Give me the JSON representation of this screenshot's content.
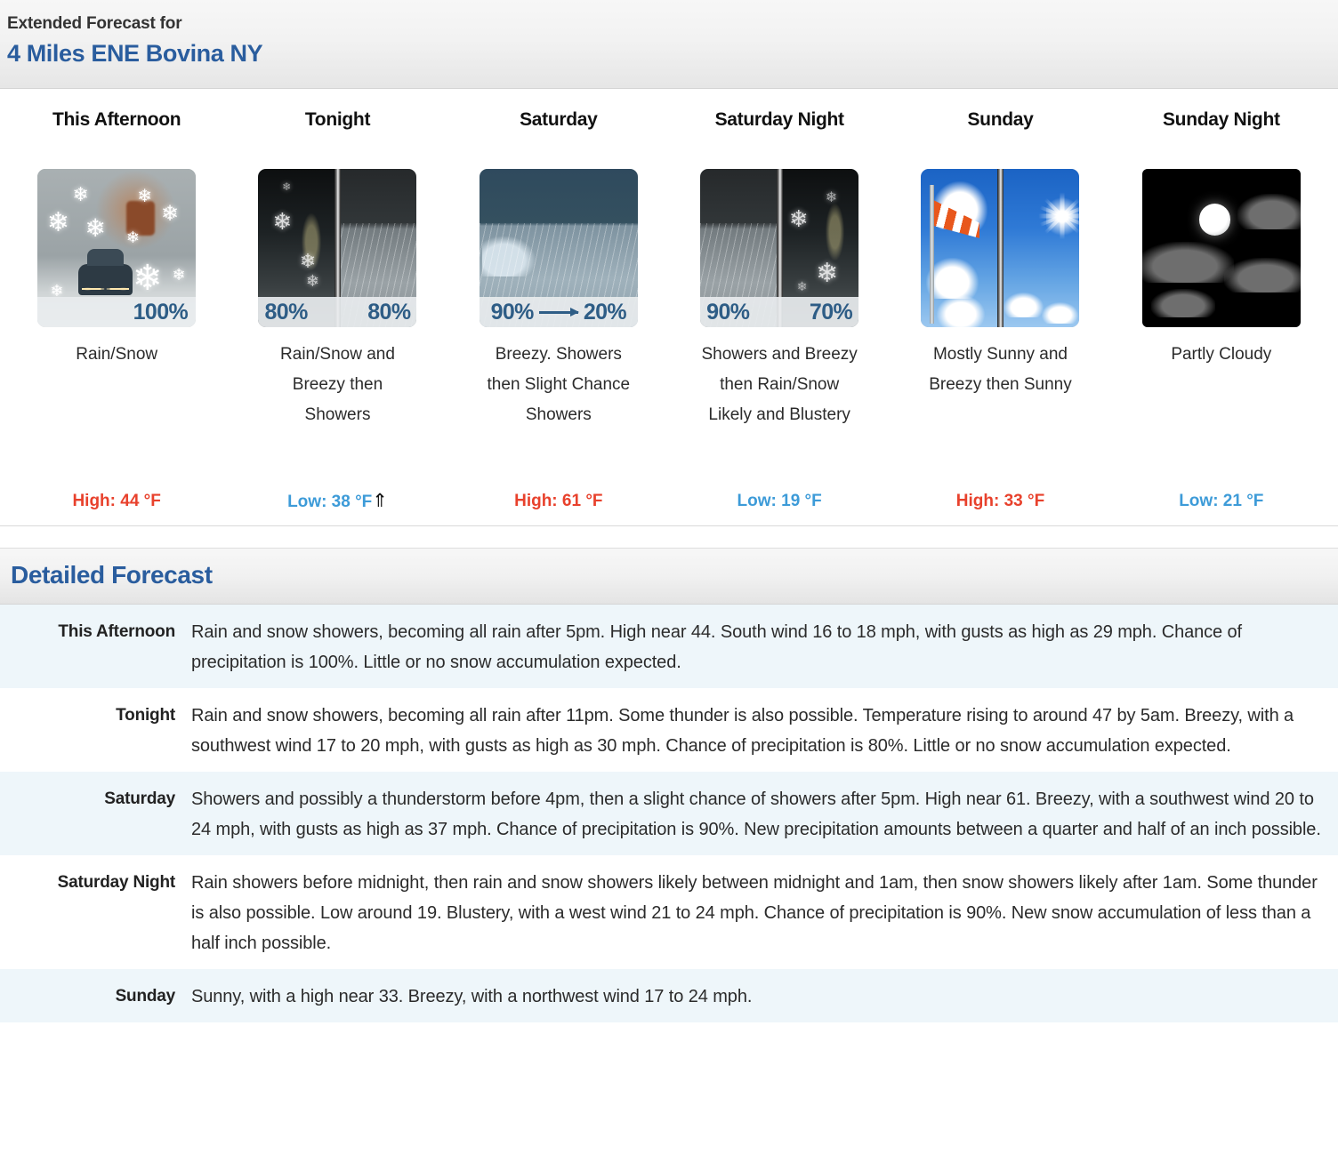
{
  "extended_forecast": {
    "heading_label": "Extended Forecast for",
    "location": "4 Miles ENE Bovina NY",
    "periods": [
      {
        "name": "This Afternoon",
        "icon": "rain-snow-road-icon",
        "pop_display": "100%",
        "pop_left": "100%",
        "pop_right": "",
        "description": "Rain/Snow",
        "temp_type": "High",
        "temp_label": "High: 44 °F",
        "trend_arrow": ""
      },
      {
        "name": "Tonight",
        "icon": "night-snow-rain-split-icon",
        "pop_display": "80% 80%",
        "pop_left": "80%",
        "pop_right": "80%",
        "description": "Rain/Snow and Breezy then Showers",
        "temp_type": "Low",
        "temp_label": "Low: 38 °F",
        "trend_arrow": "⇑"
      },
      {
        "name": "Saturday",
        "icon": "rain-showers-decreasing-icon",
        "pop_display": "90% → 20%",
        "pop_left": "90%",
        "pop_right": "20%",
        "description": "Breezy. Showers then Slight Chance Showers",
        "temp_type": "High",
        "temp_label": "High: 61 °F",
        "trend_arrow": ""
      },
      {
        "name": "Saturday Night",
        "icon": "rain-then-snow-split-icon",
        "pop_display": "90% 70%",
        "pop_left": "90%",
        "pop_right": "70%",
        "description": "Showers and Breezy then Rain/Snow Likely and Blustery",
        "temp_type": "Low",
        "temp_label": "Low: 19 °F",
        "trend_arrow": ""
      },
      {
        "name": "Sunday",
        "icon": "windy-sunny-split-icon",
        "pop_display": "",
        "pop_left": "",
        "pop_right": "",
        "description": "Mostly Sunny and Breezy then Sunny",
        "temp_type": "High",
        "temp_label": "High: 33 °F",
        "trend_arrow": ""
      },
      {
        "name": "Sunday Night",
        "icon": "partly-cloudy-night-icon",
        "pop_display": "",
        "pop_left": "",
        "pop_right": "",
        "description": "Partly Cloudy",
        "temp_type": "Low",
        "temp_label": "Low: 21 °F",
        "trend_arrow": ""
      }
    ]
  },
  "detailed_forecast": {
    "title": "Detailed Forecast",
    "rows": [
      {
        "label": "This Afternoon",
        "text": "Rain and snow showers, becoming all rain after 5pm. High near 44. South wind 16 to 18 mph, with gusts as high as 29 mph. Chance of precipitation is 100%. Little or no snow accumulation expected."
      },
      {
        "label": "Tonight",
        "text": "Rain and snow showers, becoming all rain after 11pm. Some thunder is also possible. Temperature rising to around 47 by 5am. Breezy, with a southwest wind 17 to 20 mph, with gusts as high as 30 mph. Chance of precipitation is 80%. Little or no snow accumulation expected."
      },
      {
        "label": "Saturday",
        "text": "Showers and possibly a thunderstorm before 4pm, then a slight chance of showers after 5pm. High near 61. Breezy, with a southwest wind 20 to 24 mph, with gusts as high as 37 mph. Chance of precipitation is 90%. New precipitation amounts between a quarter and half of an inch possible."
      },
      {
        "label": "Saturday Night",
        "text": "Rain showers before midnight, then rain and snow showers likely between midnight and 1am, then snow showers likely after 1am. Some thunder is also possible. Low around 19. Blustery, with a west wind 21 to 24 mph. Chance of precipitation is 90%. New snow accumulation of less than a half inch possible."
      },
      {
        "label": "Sunday",
        "text": "Sunny, with a high near 33. Breezy, with a northwest wind 17 to 24 mph."
      }
    ]
  },
  "colors": {
    "link_blue": "#2a5d9e",
    "high_red": "#e8412c",
    "low_blue": "#3d9bd8",
    "pop_blue": "#2e5d86",
    "row_stripe": "#eef6fa"
  }
}
